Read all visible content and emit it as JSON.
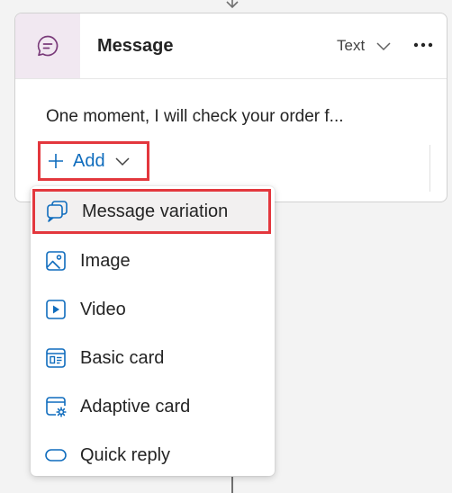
{
  "card": {
    "title": "Message",
    "type_label": "Text",
    "message_text": "One moment, I will check your order f...",
    "add_label": "Add"
  },
  "menu": {
    "items": [
      {
        "label": "Message variation",
        "icon": "message-variation-icon"
      },
      {
        "label": "Image",
        "icon": "image-icon"
      },
      {
        "label": "Video",
        "icon": "video-icon"
      },
      {
        "label": "Basic card",
        "icon": "basic-card-icon"
      },
      {
        "label": "Adaptive card",
        "icon": "adaptive-card-icon"
      },
      {
        "label": "Quick reply",
        "icon": "quick-reply-icon"
      }
    ]
  },
  "colors": {
    "accent": "#0f6cbd",
    "highlight_border": "#e3373d",
    "icon_tile_bg": "#f1e8f1",
    "message_icon": "#7a3b7a"
  }
}
